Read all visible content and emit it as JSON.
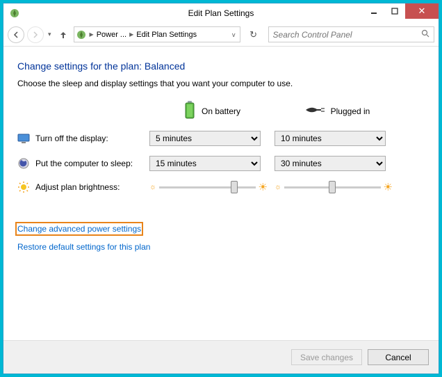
{
  "window": {
    "title": "Edit Plan Settings"
  },
  "breadcrumb": {
    "item1": "Power ...",
    "item2": "Edit Plan Settings"
  },
  "search": {
    "placeholder": "Search Control Panel"
  },
  "page": {
    "heading": "Change settings for the plan: Balanced",
    "sub": "Choose the sleep and display settings that you want your computer to use."
  },
  "columns": {
    "battery": "On battery",
    "plugged": "Plugged in"
  },
  "rows": {
    "display": {
      "label": "Turn off the display:",
      "battery": "5 minutes",
      "plugged": "10 minutes"
    },
    "sleep": {
      "label": "Put the computer to sleep:",
      "battery": "15 minutes",
      "plugged": "30 minutes"
    },
    "brightness": {
      "label": "Adjust plan brightness:"
    }
  },
  "links": {
    "advanced": "Change advanced power settings",
    "restore": "Restore default settings for this plan"
  },
  "buttons": {
    "save": "Save changes",
    "cancel": "Cancel"
  }
}
